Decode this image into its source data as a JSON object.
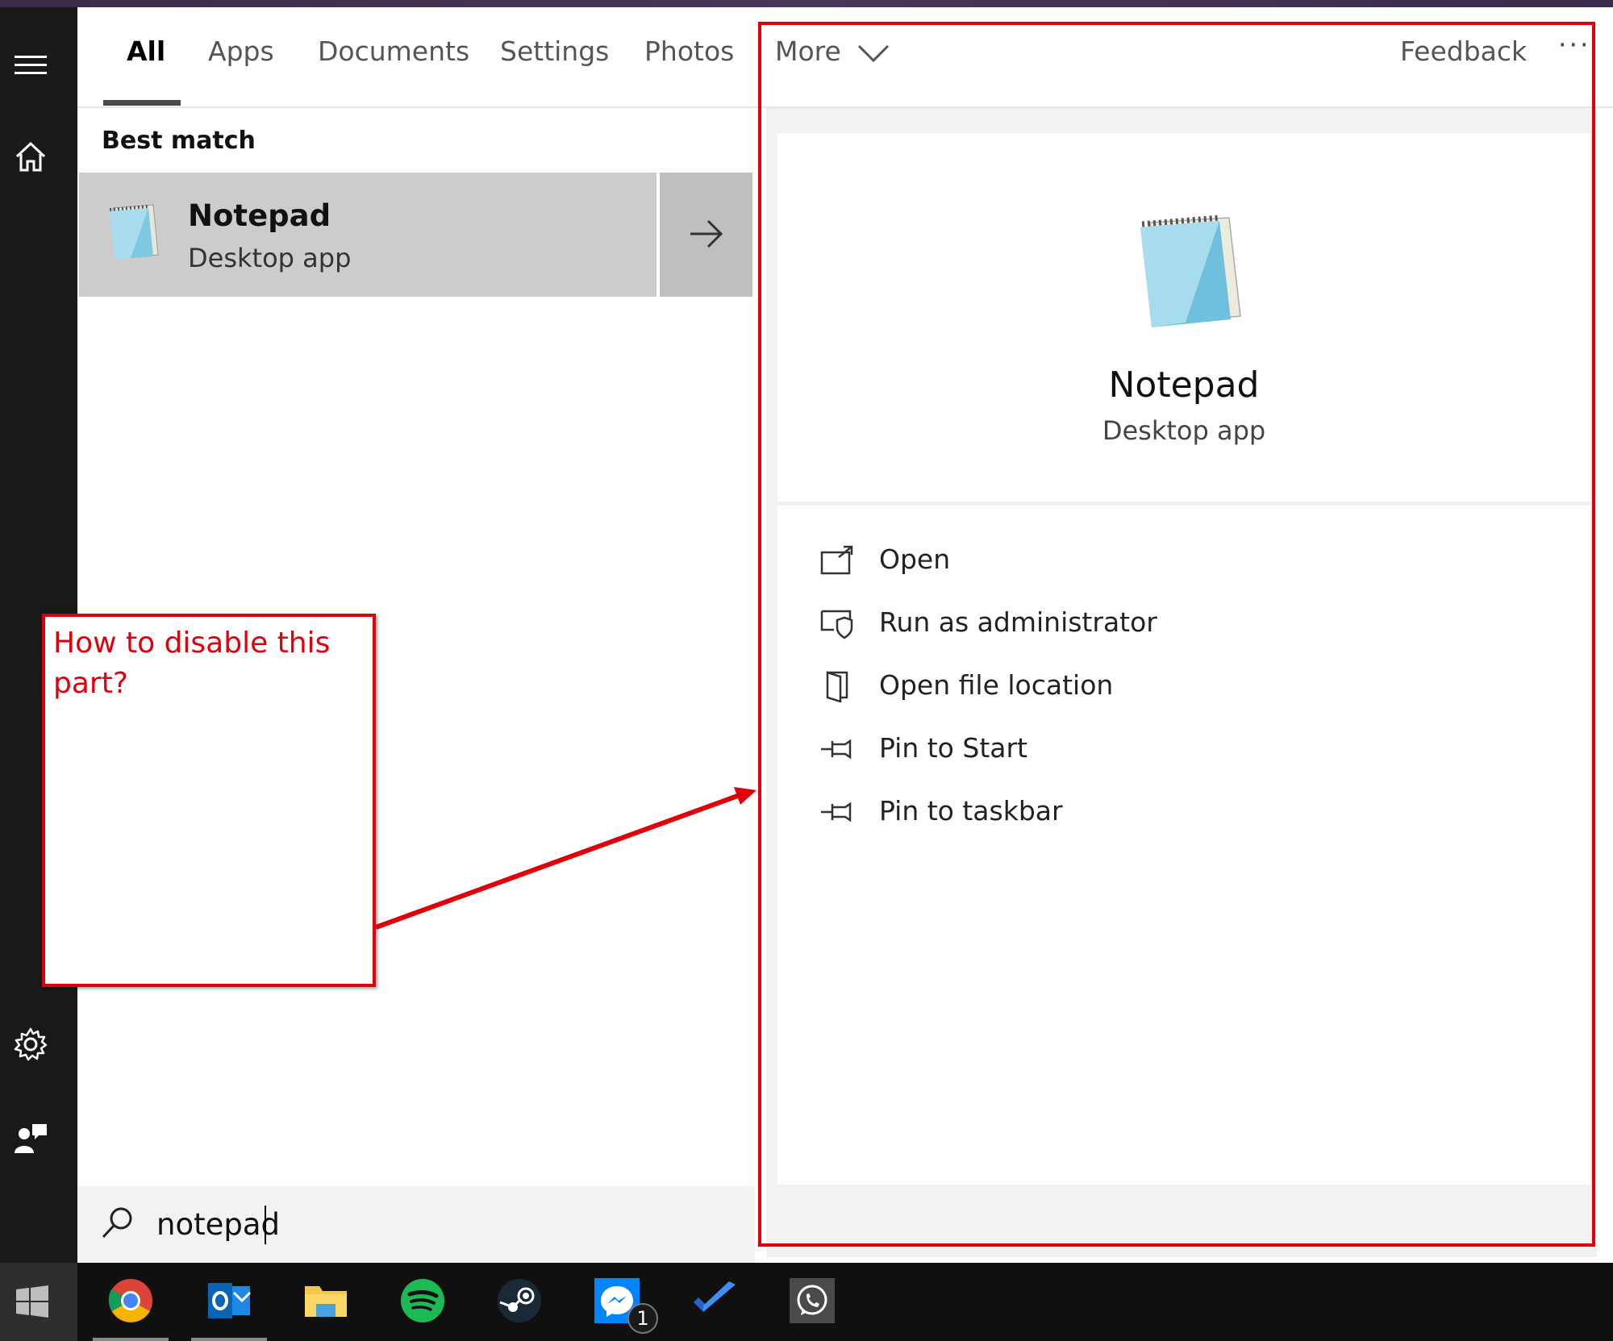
{
  "tabs": [
    {
      "label": "All"
    },
    {
      "label": "Apps"
    },
    {
      "label": "Documents"
    },
    {
      "label": "Settings"
    },
    {
      "label": "Photos"
    },
    {
      "label": "More"
    }
  ],
  "header": {
    "feedback_label": "Feedback",
    "more_options": "···"
  },
  "results": {
    "section_label": "Best match",
    "best_match": {
      "title": "Notepad",
      "subtitle": "Desktop app"
    }
  },
  "preview": {
    "title": "Notepad",
    "subtitle": "Desktop app",
    "actions": [
      {
        "label": "Open",
        "icon": "open-icon"
      },
      {
        "label": "Run as administrator",
        "icon": "shield-window-icon"
      },
      {
        "label": "Open file location",
        "icon": "folder-door-icon"
      },
      {
        "label": "Pin to Start",
        "icon": "pin-icon"
      },
      {
        "label": "Pin to taskbar",
        "icon": "pin-icon"
      }
    ]
  },
  "search": {
    "value": "notepad"
  },
  "annotation": {
    "text": "How to disable this part?"
  },
  "taskbar": {
    "apps": [
      "chrome-icon",
      "outlook-icon",
      "file-explorer-icon",
      "spotify-icon",
      "steam-icon",
      "messenger-icon",
      "todo-icon",
      "whatsapp-icon"
    ],
    "messenger_badge": "1"
  },
  "colors": {
    "annotation_red": "#e0000b",
    "rail": "#191919",
    "taskbar": "#101010",
    "selected_row": "#cccccc"
  }
}
